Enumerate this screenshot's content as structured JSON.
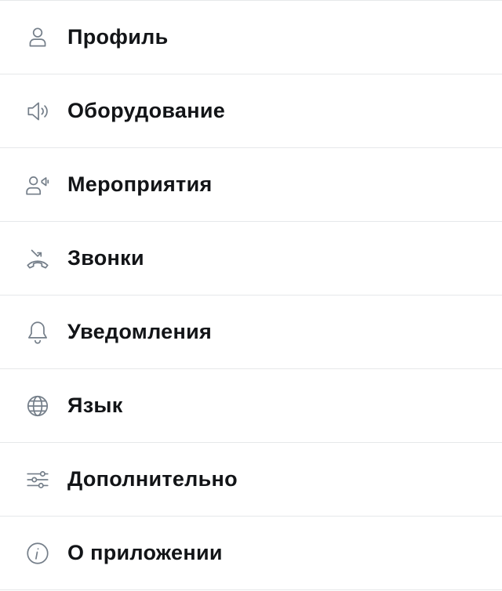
{
  "menu": {
    "items": [
      {
        "label": "Профиль",
        "icon": "person-icon"
      },
      {
        "label": "Оборудование",
        "icon": "speaker-icon"
      },
      {
        "label": "Мероприятия",
        "icon": "event-speaker-icon"
      },
      {
        "label": "Звонки",
        "icon": "call-icon"
      },
      {
        "label": "Уведомления",
        "icon": "bell-icon"
      },
      {
        "label": "Язык",
        "icon": "globe-icon"
      },
      {
        "label": "Дополнительно",
        "icon": "sliders-icon"
      },
      {
        "label": "О приложении",
        "icon": "info-icon"
      }
    ]
  },
  "colors": {
    "text": "#121417",
    "icon": "#747e89",
    "divider": "#e6e8ea",
    "background": "#ffffff"
  }
}
